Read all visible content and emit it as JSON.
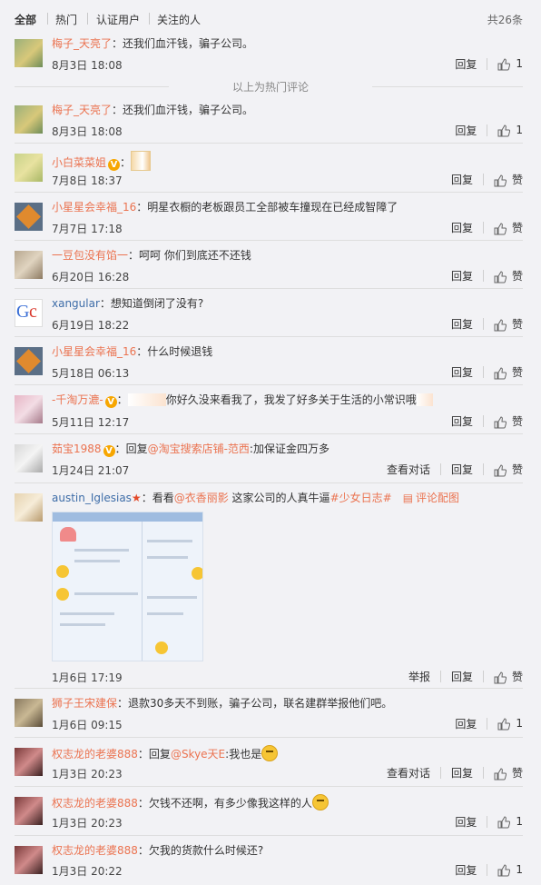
{
  "tabs": [
    "全部",
    "热门",
    "认证用户",
    "关注的人"
  ],
  "total": "共26条",
  "hot_divider": "以上为热门评论",
  "actions": {
    "reply": "回复",
    "like": "赞",
    "view_conversation": "查看对话",
    "report": "举报",
    "comment_with_image": "评论配图"
  },
  "comments": [
    {
      "user": "梅子_天亮了",
      "sep": "：",
      "text": "还我们血汗钱，骗子公司。",
      "date": "8月3日 18:08",
      "likes": "1"
    },
    {
      "user": "梅子_天亮了",
      "sep": "：",
      "text": "还我们血汗钱，骗子公司。",
      "date": "8月3日 18:08",
      "likes": "1"
    },
    {
      "user": "小白菜菜姐",
      "sep": "：",
      "text": "",
      "date": "7月8日 18:37"
    },
    {
      "user": "小星星会幸福_16",
      "sep": "：",
      "text": "明星衣橱的老板跟员工全部被车撞现在已经成智障了",
      "date": "7月7日 17:18"
    },
    {
      "user": "一豆包没有馅一",
      "sep": "：",
      "text": "呵呵  你们到底还不还钱",
      "date": "6月20日 16:28"
    },
    {
      "user": "xangular",
      "sep": "：",
      "text": "想知道倒闭了没有?",
      "date": "6月19日 18:22"
    },
    {
      "user": "小星星会幸福_16",
      "sep": "：",
      "text": "什么时候退钱",
      "date": "5月18日 06:13"
    },
    {
      "user": "-千淘万漉-",
      "sep": "：",
      "text": "你好久没来看我了，我发了好多关于生活的小常识哦",
      "date": "5月11日 12:17"
    },
    {
      "user": "茹宝1988",
      "sep": "：",
      "text_prefix": "回复",
      "mention": "@淘宝搜索店铺-范西",
      "text": ":加保证金四万多",
      "date": "1月24日 21:07"
    },
    {
      "user": "austin_Iglesias",
      "sep": "：",
      "text_prefix": "看看",
      "mention": "@衣香丽影",
      "text": " 这家公司的人真牛逼",
      "hashtag": "#少女日志#",
      "date": "1月6日 17:19"
    },
    {
      "user": "狮子王宋建保",
      "sep": "：",
      "text": "退款30多天不到账，骗子公司，联名建群举报他们吧。",
      "date": "1月6日 09:15",
      "likes": "1"
    },
    {
      "user": "权志龙的老婆888",
      "sep": "：",
      "text_prefix": "回复",
      "mention": "@Skye天E",
      "text": ":我也是",
      "date": "1月3日 20:23"
    },
    {
      "user": "权志龙的老婆888",
      "sep": "：",
      "text": "欠钱不还啊，有多少像我这样的人",
      "date": "1月3日 20:23",
      "likes": "1"
    },
    {
      "user": "权志龙的老婆888",
      "sep": "：",
      "text": "欠我的货款什么时候还?",
      "date": "1月3日 20:22",
      "likes": "1"
    }
  ]
}
